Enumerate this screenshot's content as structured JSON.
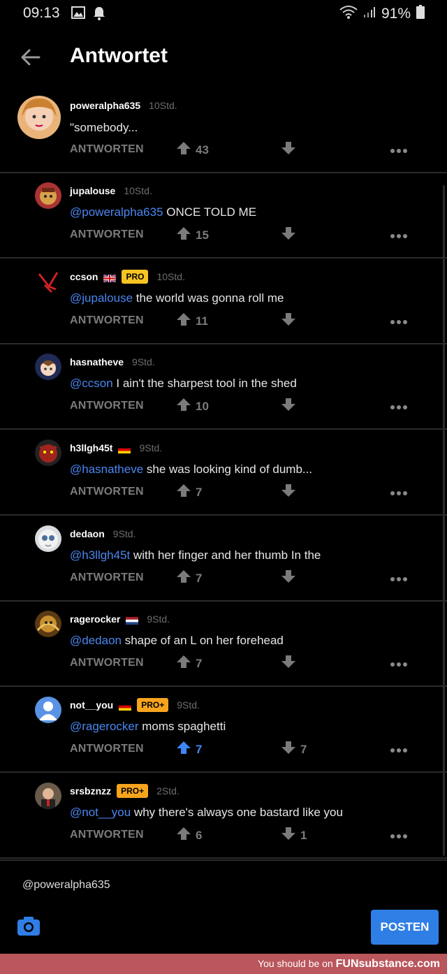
{
  "status_bar": {
    "time": "09:13",
    "battery": "91%"
  },
  "header": {
    "title": "Antwortet"
  },
  "reply_label": "ANTWORTEN",
  "comments": [
    {
      "username": "poweralpha635",
      "time": "10Std.",
      "mention": "",
      "text": "\"somebody...",
      "upvotes": "43",
      "downvotes": "",
      "badge": "",
      "flag": ""
    },
    {
      "username": "jupalouse",
      "time": "10Std.",
      "mention": "@poweralpha635",
      "text": " ONCE TOLD ME",
      "upvotes": "15",
      "downvotes": "",
      "badge": "",
      "flag": ""
    },
    {
      "username": "ccson",
      "time": "10Std.",
      "mention": "@jupalouse",
      "text": " the world was gonna roll me",
      "upvotes": "11",
      "downvotes": "",
      "badge": "PRO",
      "flag": "uk"
    },
    {
      "username": "hasnatheve",
      "time": "9Std.",
      "mention": "@ccson",
      "text": " I ain't the sharpest tool in the shed",
      "upvotes": "10",
      "downvotes": "",
      "badge": "",
      "flag": ""
    },
    {
      "username": "h3llgh45t",
      "time": "9Std.",
      "mention": "@hasnatheve",
      "text": " she was looking kind of dumb...",
      "upvotes": "7",
      "downvotes": "",
      "badge": "",
      "flag": "de"
    },
    {
      "username": "dedaon",
      "time": "9Std.",
      "mention": "@h3llgh45t",
      "text": " with her finger and her thumb In the",
      "upvotes": "7",
      "downvotes": "",
      "badge": "",
      "flag": ""
    },
    {
      "username": "ragerocker",
      "time": "9Std.",
      "mention": "@dedaon",
      "text": " shape of an L on her forehead",
      "upvotes": "7",
      "downvotes": "",
      "badge": "",
      "flag": "nl"
    },
    {
      "username": "not__you",
      "time": "9Std.",
      "mention": "@ragerocker",
      "text": " moms spaghetti",
      "upvotes": "7",
      "downvotes": "7",
      "badge": "PRO+",
      "flag": "de"
    },
    {
      "username": "srsbznzz",
      "time": "2Std.",
      "mention": "@not__you",
      "text": " why there's always one bastard like you",
      "upvotes": "6",
      "downvotes": "1",
      "badge": "PRO+",
      "flag": ""
    }
  ],
  "composer": {
    "value": "@poweralpha635",
    "post_label": "POSTEN"
  },
  "watermark": {
    "prefix": "You should be on ",
    "brand": "FUNsubstance.com"
  },
  "colors": {
    "mention": "#4a86f0",
    "badge": "#f7b324",
    "post_button": "#2f7ee6",
    "upvote_active": "#3e86f5"
  }
}
